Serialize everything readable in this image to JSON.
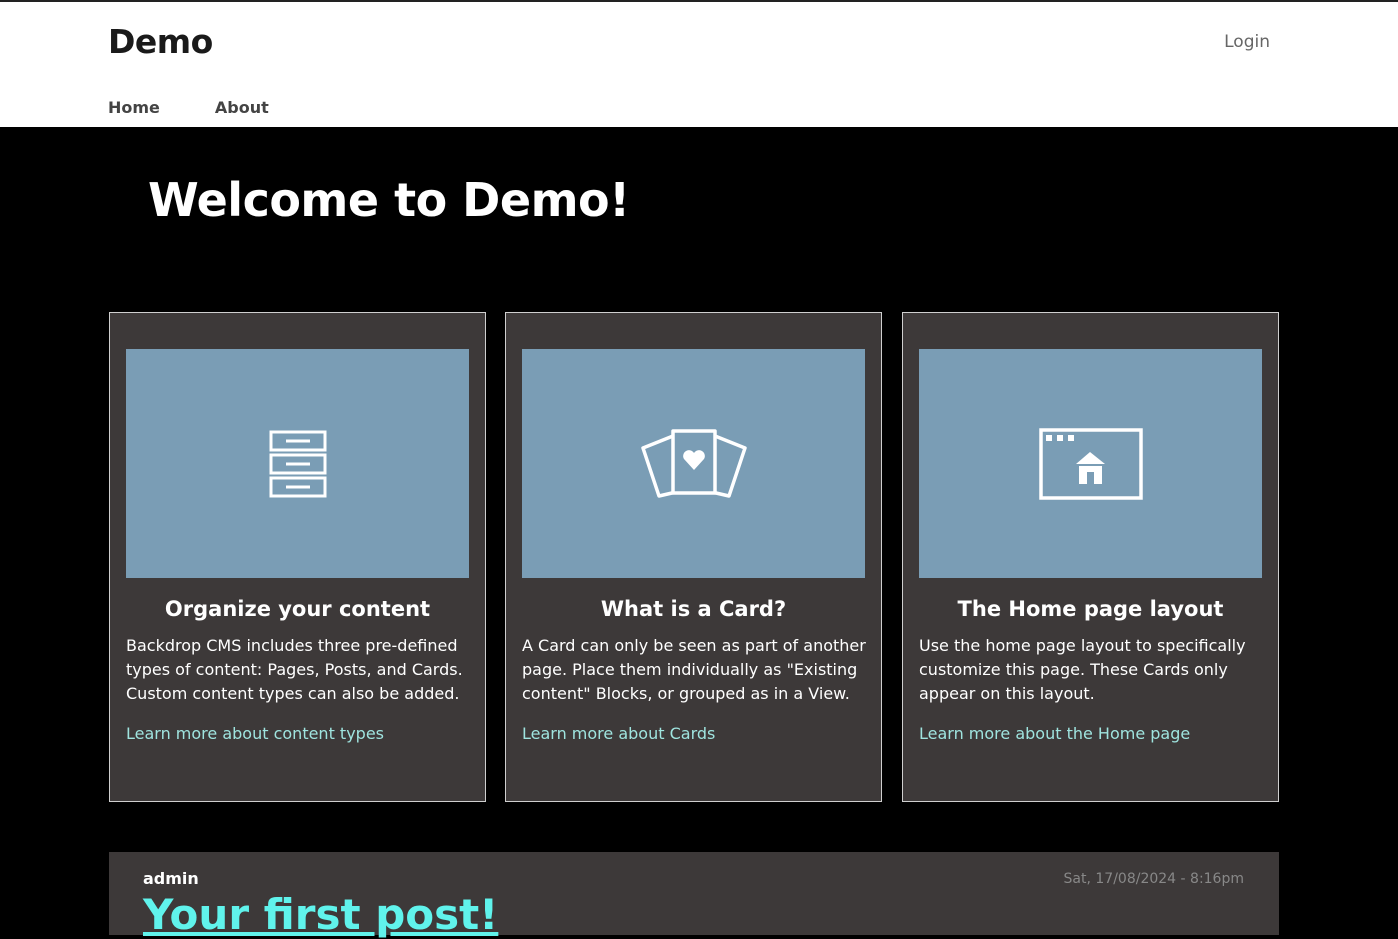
{
  "header": {
    "logo": "Demo",
    "login_label": "Login",
    "nav": [
      {
        "label": "Home"
      },
      {
        "label": "About"
      }
    ]
  },
  "hero": {
    "title": "Welcome to Demo!"
  },
  "cards": [
    {
      "icon": "filing-cabinet-icon",
      "title": "Organize your content",
      "body": "Backdrop CMS includes three pre-defined types of content: Pages, Posts, and Cards. Custom content types can also be added.",
      "link": "Learn more about content types"
    },
    {
      "icon": "playing-cards-icon",
      "title": "What is a Card?",
      "body": "A Card can only be seen as part of another page. Place them individually as \"Existing content\" Blocks, or grouped as in a View.",
      "link": "Learn more about Cards"
    },
    {
      "icon": "home-layout-icon",
      "title": "The Home page layout",
      "body": "Use the home page layout to specifically customize this page. These Cards only appear on this layout.",
      "link": "Learn more about the Home page"
    }
  ],
  "post": {
    "author": "admin",
    "date": "Sat, 17/08/2024 - 8:16pm",
    "title": "Your first post!"
  },
  "colors": {
    "card_image_bg": "#7a9db5",
    "card_bg": "#3d3939",
    "link": "#9fe4df",
    "post_title": "#60f3ec"
  }
}
